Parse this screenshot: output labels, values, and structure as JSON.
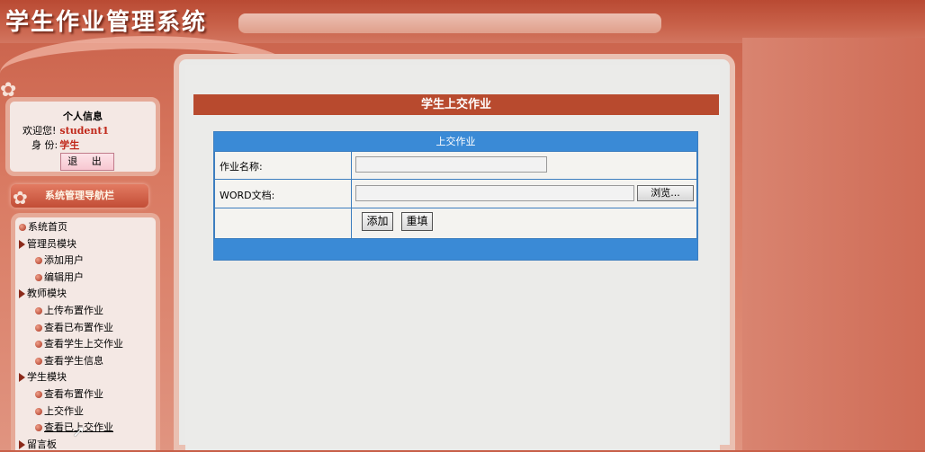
{
  "app": {
    "title": "学生作业管理系统"
  },
  "user_panel": {
    "title": "个人信息",
    "welcome_label": "欢迎您!",
    "username": "student1",
    "role_label": "身  份:",
    "role": "学生",
    "logout_label": "退 出"
  },
  "nav": {
    "header": "系统管理导航栏",
    "items": [
      {
        "label": "系统首页",
        "level": 0,
        "icon": "ball"
      },
      {
        "label": "管理员模块",
        "level": 0,
        "icon": "arrow"
      },
      {
        "label": "添加用户",
        "level": 1,
        "icon": "ball"
      },
      {
        "label": "编辑用户",
        "level": 1,
        "icon": "ball"
      },
      {
        "label": "教师模块",
        "level": 0,
        "icon": "arrow"
      },
      {
        "label": "上传布置作业",
        "level": 1,
        "icon": "ball"
      },
      {
        "label": "查看已布置作业",
        "level": 1,
        "icon": "ball"
      },
      {
        "label": "查看学生上交作业",
        "level": 1,
        "icon": "ball"
      },
      {
        "label": "查看学生信息",
        "level": 1,
        "icon": "ball"
      },
      {
        "label": "学生模块",
        "level": 0,
        "icon": "arrow"
      },
      {
        "label": "查看布置作业",
        "level": 1,
        "icon": "ball"
      },
      {
        "label": "上交作业",
        "level": 1,
        "icon": "ball"
      },
      {
        "label": "查看已上交作业",
        "level": 1,
        "icon": "ball"
      },
      {
        "label": "留言板",
        "level": 0,
        "icon": "arrow"
      }
    ]
  },
  "main": {
    "page_title": "学生上交作业",
    "form": {
      "caption": "上交作业",
      "name_label": "作业名称:",
      "name_value": "",
      "doc_label": "WORD文档:",
      "doc_value": "",
      "browse_label": "浏览...",
      "add_label": "添加",
      "reset_label": "重填"
    }
  },
  "colors": {
    "title_bar": "#b84a2e",
    "form_header": "#3a8ad6",
    "accent_text": "#c0281a"
  }
}
